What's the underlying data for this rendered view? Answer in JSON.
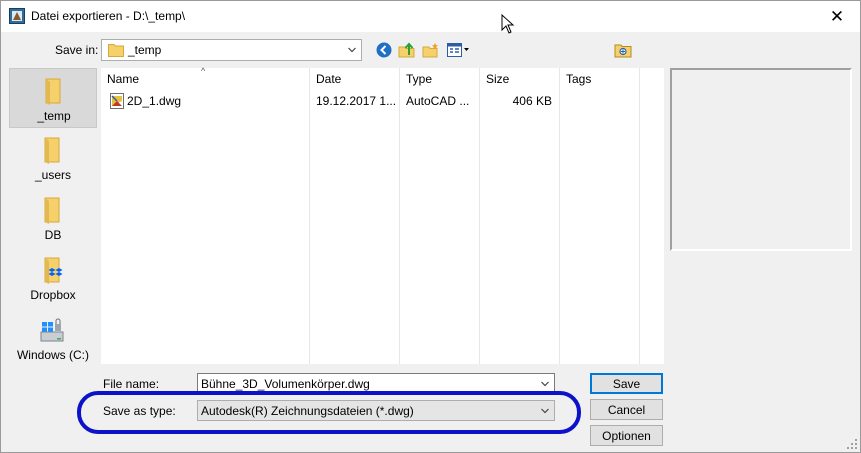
{
  "window": {
    "title": "Datei exportieren - D:\\_temp\\",
    "close_glyph": "✕"
  },
  "toolbar": {
    "save_in_label": "Save in:",
    "save_in_value": "_temp",
    "icons": [
      "back-icon",
      "up-folder-icon",
      "new-folder-icon",
      "view-menu-icon",
      "find-file-icon"
    ]
  },
  "places": [
    {
      "label": "_temp",
      "icon": "folder-icon",
      "selected": true
    },
    {
      "label": "_users",
      "icon": "folder-icon",
      "selected": false
    },
    {
      "label": "DB",
      "icon": "folder-icon",
      "selected": false
    },
    {
      "label": "Dropbox",
      "icon": "dropbox-folder-icon",
      "selected": false
    },
    {
      "label": "Windows (C:)",
      "icon": "windows-drive-icon",
      "selected": false
    }
  ],
  "filelist": {
    "columns": [
      "Name",
      "Date",
      "Type",
      "Size",
      "Tags"
    ],
    "rows": [
      {
        "name": "2D_1.dwg",
        "date": "19.12.2017 1...",
        "type": "AutoCAD ...",
        "size": "406 KB",
        "tags": ""
      }
    ]
  },
  "form": {
    "file_name_label": "File name:",
    "file_name_value": "Bühne_3D_Volumenkörper.dwg",
    "save_as_type_label": "Save as type:",
    "save_as_type_value": "Autodesk(R) Zeichnungsdateien (*.dwg)"
  },
  "buttons": {
    "save": "Save",
    "cancel": "Cancel",
    "options": "Optionen"
  },
  "colors": {
    "highlight": "#0b12c8",
    "default_button_border": "#0078d7",
    "folder_yellow": "#f6d06a"
  }
}
